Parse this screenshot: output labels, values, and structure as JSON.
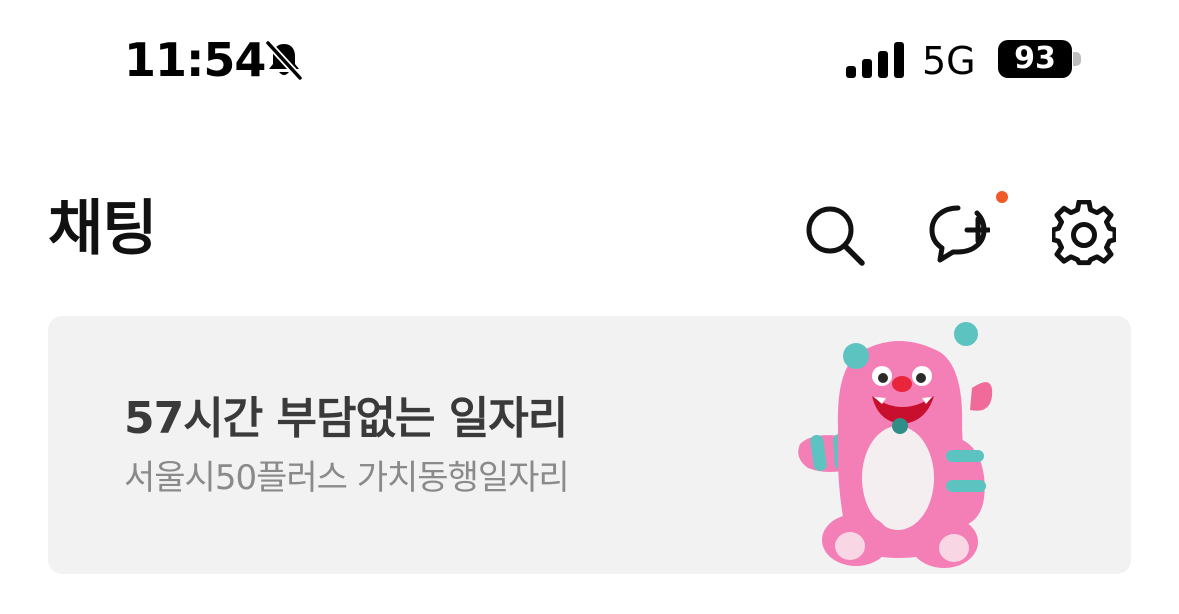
{
  "status_bar": {
    "time": "11:54",
    "network": "5G",
    "battery": "93",
    "icons": [
      "bell-slash-icon",
      "signal-bars-icon",
      "battery-icon"
    ]
  },
  "header": {
    "title": "채팅",
    "icons": [
      "search-icon",
      "new-chat-icon",
      "gear-icon"
    ],
    "notification_dot_color": "#f05a28"
  },
  "banner": {
    "title": "57시간 부담없는 일자리",
    "subtitle": "서울시50플러스 가치동행일자리",
    "background": "#f2f2f2",
    "image": "pink-monster-mascot"
  }
}
